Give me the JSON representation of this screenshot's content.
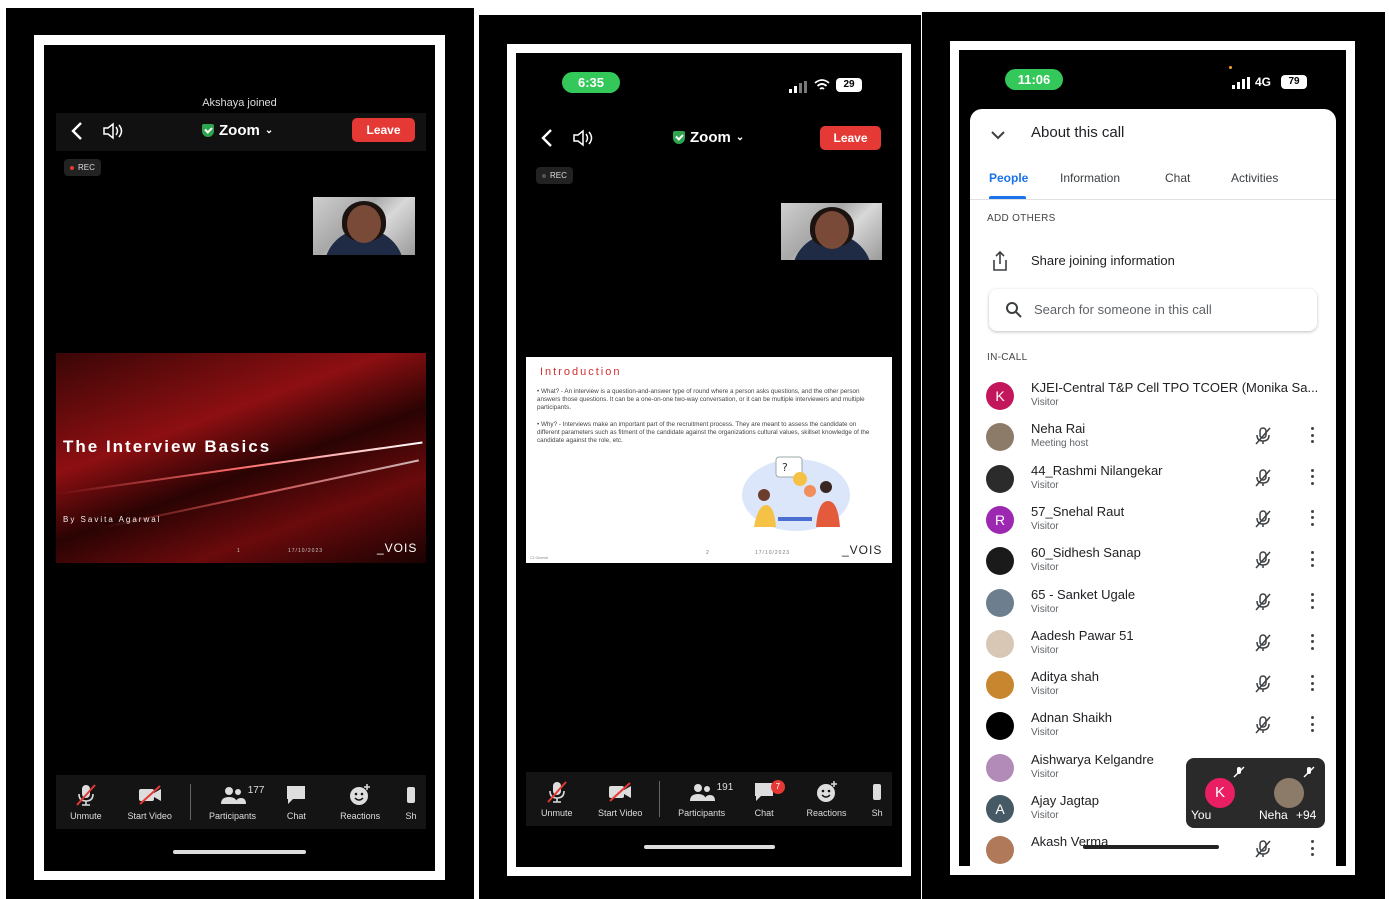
{
  "screen1": {
    "notice": "Akshaya joined",
    "title": "Zoom",
    "leave": "Leave",
    "rec": "REC",
    "slide": {
      "title": "The Interview Basics",
      "author": "By Savita Agarwal",
      "page": "1",
      "date": "17/10/2023",
      "logo": "_VOIS"
    },
    "toolbar": {
      "unmute": "Unmute",
      "start_video": "Start Video",
      "participants": "Participants",
      "participants_count": "177",
      "chat": "Chat",
      "reactions": "Reactions",
      "share": "Sh"
    }
  },
  "screen2": {
    "time": "6:35",
    "battery": "29",
    "title": "Zoom",
    "leave": "Leave",
    "rec": "REC",
    "slide": {
      "heading": "Introduction",
      "bullet1": "What? - An interview is a question-and-answer type of round where a person asks questions, and the other person answers those questions. It can be a one-on-one two-way conversation, or it can be multiple interviewers and multiple participants.",
      "bullet2": "Why? - Interviews make an important part of the recruitment process. They are meant to assess the candidate on different parameters such as fitment of the candidate against the organizations cultural values, skillset knowledge of the candidate against the role, etc.",
      "footer_left": "C2 General",
      "page": "2",
      "date": "17/10/2023",
      "logo": "_VOIS"
    },
    "toolbar": {
      "unmute": "Unmute",
      "start_video": "Start Video",
      "participants": "Participants",
      "participants_count": "191",
      "chat": "Chat",
      "chat_badge": "7",
      "reactions": "Reactions",
      "share": "Sh"
    }
  },
  "screen3": {
    "time": "11:06",
    "network": "4G",
    "battery": "79",
    "header": "About this call",
    "tabs": [
      "People",
      "Information",
      "Chat",
      "Activities"
    ],
    "add_others": "ADD OTHERS",
    "share_info": "Share joining information",
    "search_placeholder": "Search for someone in this call",
    "in_call": "IN-CALL",
    "people": [
      {
        "name": "KJEI-Central T&P Cell TPO TCOER (Monika Sa...",
        "role": "Visitor",
        "initial": "K",
        "color": "#c2185b"
      },
      {
        "name": "Neha Rai",
        "role": "Meeting host",
        "initial": "",
        "color": "#8d7b6a"
      },
      {
        "name": "44_Rashmi Nilangekar",
        "role": "Visitor",
        "initial": "",
        "color": "#2b2b2b"
      },
      {
        "name": "57_Snehal Raut",
        "role": "Visitor",
        "initial": "R",
        "color": "#9c27b0"
      },
      {
        "name": "60_Sidhesh Sanap",
        "role": "Visitor",
        "initial": "",
        "color": "#1a1a1a"
      },
      {
        "name": "65 - Sanket Ugale",
        "role": "Visitor",
        "initial": "",
        "color": "#6d7f8e"
      },
      {
        "name": "Aadesh Pawar 51",
        "role": "Visitor",
        "initial": "",
        "color": "#d8c7b5"
      },
      {
        "name": "Aditya shah",
        "role": "Visitor",
        "initial": "",
        "color": "#c8872f"
      },
      {
        "name": "Adnan Shaikh",
        "role": "Visitor",
        "initial": "",
        "color": "#000000"
      },
      {
        "name": "Aishwarya Kelgandre",
        "role": "Visitor",
        "initial": "",
        "color": "#b38bb8"
      },
      {
        "name": "Ajay Jagtap",
        "role": "Visitor",
        "initial": "A",
        "color": "#455a64"
      },
      {
        "name": "Akash Verma",
        "role": "",
        "initial": "",
        "color": "#b07a5a"
      }
    ],
    "pip": {
      "you_initial": "K",
      "you_label": "You",
      "other_label": "Neha",
      "more": "+94"
    }
  }
}
